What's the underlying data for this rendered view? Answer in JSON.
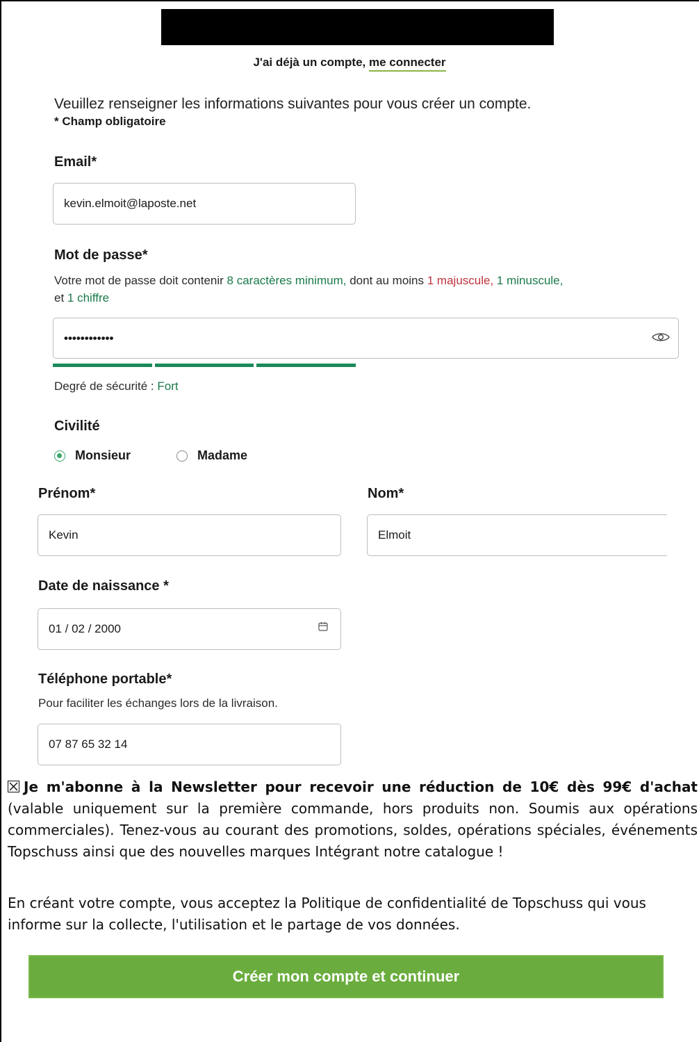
{
  "header": {
    "login_prefix": "J'ai déjà un compte,",
    "login_link": "me connecter"
  },
  "form": {
    "intro": "Veuillez renseigner les informations suivantes pour vous créer un compte.",
    "required_note": "* Champ obligatoire",
    "email": {
      "label": "Email*",
      "value": "kevin.elmoit@laposte.net"
    },
    "password": {
      "label": "Mot de passe*",
      "hint": {
        "p1": "Votre mot de passe doit contenir",
        "min_chars": "8 caractères minimum,",
        "p2": "dont au moins",
        "upper": "1 majuscule,",
        "lower": "1 minuscule,",
        "p3": "et",
        "digit": "1 chiffre"
      },
      "value": "••••••••••••",
      "strength_label": "Degré de sécurité :",
      "strength_value": "Fort",
      "strength_level": 1.0
    },
    "civility": {
      "label": "Civilité",
      "options": [
        "Monsieur",
        "Madame"
      ],
      "selected": "Monsieur"
    },
    "firstname": {
      "label": "Prénom*",
      "value": "Kevin"
    },
    "lastname": {
      "label": "Nom*",
      "value": "Elmoit"
    },
    "birthdate": {
      "label": "Date de naissance *",
      "value": "01 / 02 / 2000"
    },
    "mobile": {
      "label": "Téléphone portable*",
      "hint": "Pour faciliter les échanges lors de la livraison.",
      "value": "07 87 65 32 14"
    },
    "newsletter": {
      "bold": "Je m'abonne à la Newsletter pour recevoir une réduction de 10€ dès 99€ d'achat",
      "rest": "(valable uniquement sur la première commande, hors produits non. Soumis aux opérations commerciales). Tenez-vous au courant des promotions, soldes, opérations spéciales, événements Topschuss ainsi que des nouvelles marques Intégrant notre catalogue !"
    },
    "policy": "En créant votre compte, vous acceptez la Politique de confidentialité de Topschuss qui vous informe sur la collecte, l'utilisation et le partage de vos données.",
    "submit_label": "Créer mon compte et continuer"
  },
  "colors": {
    "accent_green": "#6aad3e",
    "strong_green": "#1a8a5a",
    "error_red": "#c0333d"
  }
}
